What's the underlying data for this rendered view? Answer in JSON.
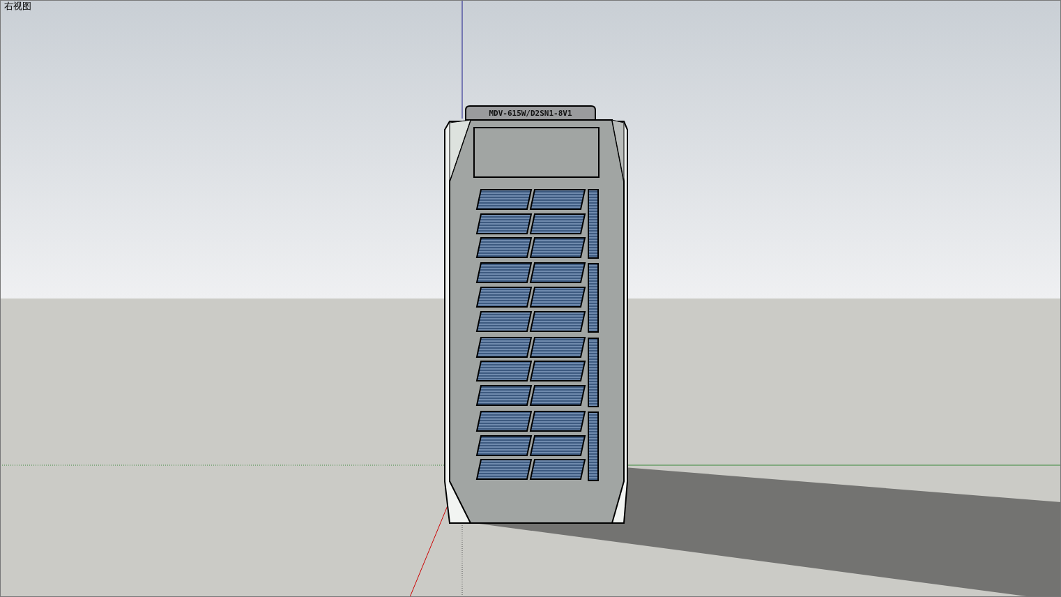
{
  "viewport": {
    "view_name": "右视图"
  },
  "model": {
    "label": "MDV-615W/D2SN1-8V1"
  }
}
